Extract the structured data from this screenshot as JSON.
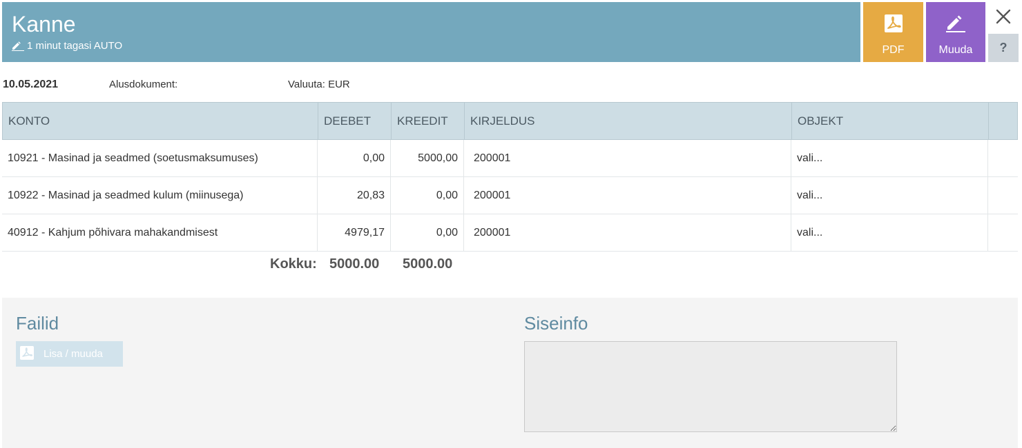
{
  "header": {
    "title": "Kanne",
    "subtitle": "1 minut tagasi AUTO",
    "pdf_label": "PDF",
    "edit_label": "Muuda",
    "help_label": "?",
    "colors": {
      "header_bg": "#74a8bd",
      "pdf_bg": "#e6aa43",
      "edit_bg": "#8f62c9"
    }
  },
  "info": {
    "date": "10.05.2021",
    "alusdokument": "Alusdokument:",
    "valuuta": "Valuuta: EUR"
  },
  "table": {
    "headers": [
      "KONTO",
      "DEEBET",
      "KREEDIT",
      "KIRJELDUS",
      "OBJEKT"
    ],
    "rows": [
      {
        "konto": "10921 - Masinad ja seadmed (soetusmaksumuses)",
        "deebet": "0,00",
        "kreedit": "5000,00",
        "kirjeldus": "200001",
        "objekt": "vali..."
      },
      {
        "konto": "10922 - Masinad ja seadmed kulum (miinusega)",
        "deebet": "20,83",
        "kreedit": "0,00",
        "kirjeldus": "200001",
        "objekt": "vali..."
      },
      {
        "konto": "40912 - Kahjum põhivara mahakandmisest",
        "deebet": "4979,17",
        "kreedit": "0,00",
        "kirjeldus": "200001",
        "objekt": "vali..."
      }
    ],
    "totals": {
      "label": "Kokku:",
      "deebet": "5000.00",
      "kreedit": "5000.00"
    }
  },
  "files": {
    "title": "Failid",
    "button_label": "Lisa / muuda"
  },
  "siseinfo": {
    "title": "Siseinfo",
    "value": ""
  }
}
